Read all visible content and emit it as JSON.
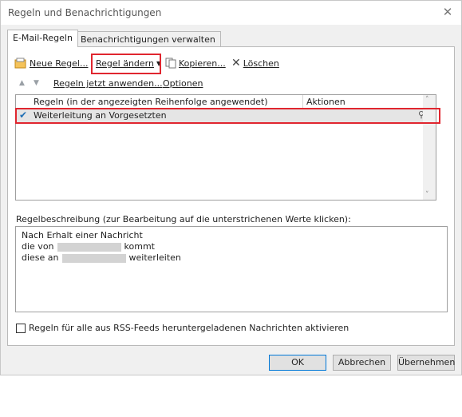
{
  "window": {
    "title": "Regeln und Benachrichtigungen"
  },
  "tabs": [
    {
      "label": "E-Mail-Regeln"
    },
    {
      "label": "Benachrichtigungen verwalten"
    }
  ],
  "toolbar": {
    "new_rule": "Neue Regel...",
    "change_rule": "Regel ändern",
    "copy": "Kopieren...",
    "delete": "Löschen"
  },
  "subbar": {
    "run_rules": "Regeln jetzt anwenden...",
    "options": "Optionen"
  },
  "rule_list": {
    "columns": [
      "Regeln (in der angezeigten Reihenfolge angewendet)",
      "Aktionen"
    ],
    "rows": [
      {
        "name": "Weiterleitung an Vorgesetzten",
        "checked": true
      }
    ]
  },
  "description": {
    "label": "Regelbeschreibung (zur Bearbeitung auf die unterstrichenen Werte klicken):",
    "line1": "Nach Erhalt einer Nachricht",
    "line2_prefix": "die von",
    "line2_suffix": "kommt",
    "line3_prefix": "diese an",
    "line3_suffix": "weiterleiten"
  },
  "rss_checkbox": {
    "label": "Regeln für alle aus RSS-Feeds heruntergeladenen Nachrichten aktivieren",
    "checked": false
  },
  "buttons": {
    "ok": "OK",
    "cancel": "Abbrechen",
    "apply": "Übernehmen"
  },
  "colors": {
    "highlight": "#e0262f",
    "accent": "#0078d7"
  }
}
